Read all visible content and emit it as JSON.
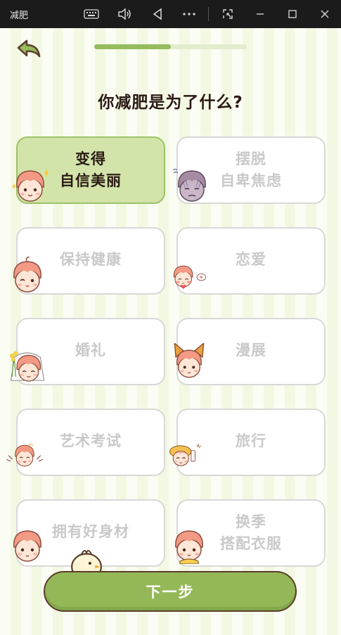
{
  "window": {
    "title": "减肥",
    "icons": [
      "keyboard-icon",
      "volume-icon",
      "back-triangle-icon",
      "more-icon",
      "screenshot-icon",
      "minimize-icon",
      "maximize-icon",
      "close-icon"
    ]
  },
  "progress": {
    "fraction": 0.5
  },
  "question": "你减肥是为了什么?",
  "options": [
    {
      "lines": [
        "变得",
        "自信美丽"
      ],
      "selected": true
    },
    {
      "lines": [
        "摆脱",
        "自卑焦虑"
      ],
      "selected": false
    },
    {
      "lines": [
        "保持健康"
      ],
      "selected": false
    },
    {
      "lines": [
        "恋爱"
      ],
      "selected": false
    },
    {
      "lines": [
        "婚礼"
      ],
      "selected": false
    },
    {
      "lines": [
        "漫展"
      ],
      "selected": false
    },
    {
      "lines": [
        "艺术考试"
      ],
      "selected": false
    },
    {
      "lines": [
        "旅行"
      ],
      "selected": false
    },
    {
      "lines": [
        "拥有好身材"
      ],
      "selected": false
    },
    {
      "lines": [
        "换季",
        "搭配衣服"
      ],
      "selected": false
    }
  ],
  "next_button": "下一步",
  "colors": {
    "accent": "#95bd5e",
    "selected_bg": "#d2e4a9",
    "unselected_text": "#c9c9c9",
    "dark_text": "#2a1a14",
    "hair": "#f39a84",
    "skin": "#ffe6d6"
  }
}
